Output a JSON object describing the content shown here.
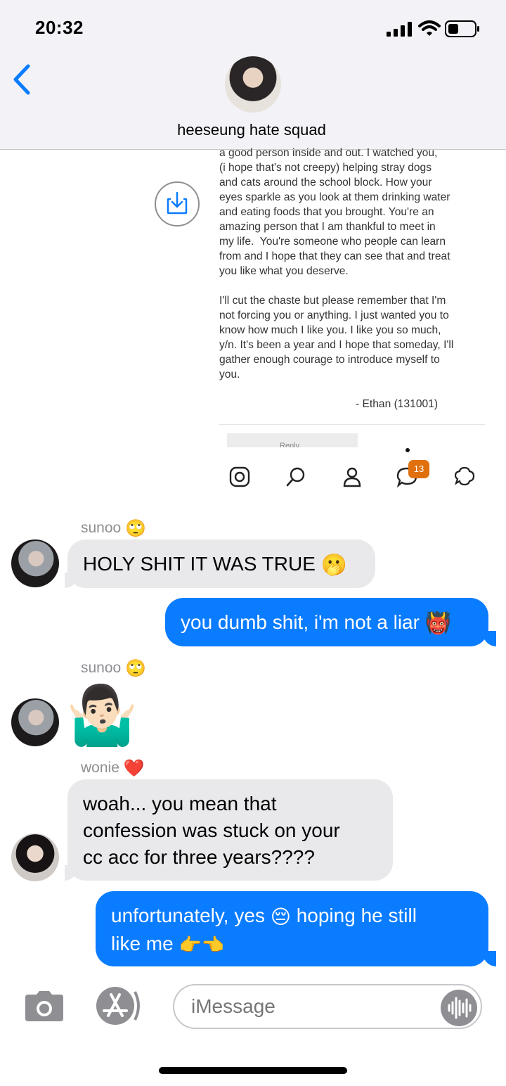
{
  "status_bar": {
    "time": "20:32"
  },
  "header": {
    "group_name": "heeseung hate squad",
    "avatar": "group-avatar-photo"
  },
  "shared_screenshot": {
    "letter_text": "a good person inside and out. I watched you,\n(i hope that's not creepy) helping stray dogs\nand cats around the school block. How your\neyes sparkle as you look at them drinking water\nand eating foods that you brought. You're an\namazing person that I am thankful to meet in\nmy life.  You're someone who people can learn\nfrom and I hope that they can see that and treat\nyou like what you deserve.\n\nI'll cut the chaste but please remember that I'm\nnot forcing you or anything. I just wanted you to\nknow how much I like you. I like you so much,\ny/n. It's been a year and I hope that someday, I'll\ngather enough courage to introduce myself to\nyou.",
    "signature": "- Ethan (131001)",
    "reply_label": "Reply",
    "tabs": [
      "instagram-icon",
      "search-icon",
      "profile-icon",
      "chat-icon",
      "ask-icon"
    ],
    "badge_count": "13"
  },
  "messages": [
    {
      "sender": "sunoo",
      "sender_emoji": "🙄",
      "text": "HOLY SHIT IT WAS TRUE",
      "emoji": "🫢"
    },
    {
      "outgoing": true,
      "text": "you dumb shit, i'm not a liar",
      "emoji": "👹"
    },
    {
      "sender": "sunoo",
      "sender_emoji": "🙄",
      "emoji": "🤷🏻‍♂️"
    },
    {
      "sender": "wonie",
      "sender_emoji": "❤️",
      "lines": [
        "woah... you mean that",
        "confession was stuck on your",
        "cc acc for three years????"
      ]
    },
    {
      "outgoing": true,
      "text": "unfortunately, yes 😔 hoping he still like me 👉👈",
      "lines": [
        "unfortunately, yes",
        "hoping he still",
        "like me"
      ]
    }
  ],
  "composer": {
    "placeholder": "iMessage"
  },
  "colors": {
    "outgoing_bubble": "#0a7cff",
    "incoming_bubble": "#e9e9eb",
    "accent": "#0a7cff",
    "badge": "#e0700d"
  }
}
